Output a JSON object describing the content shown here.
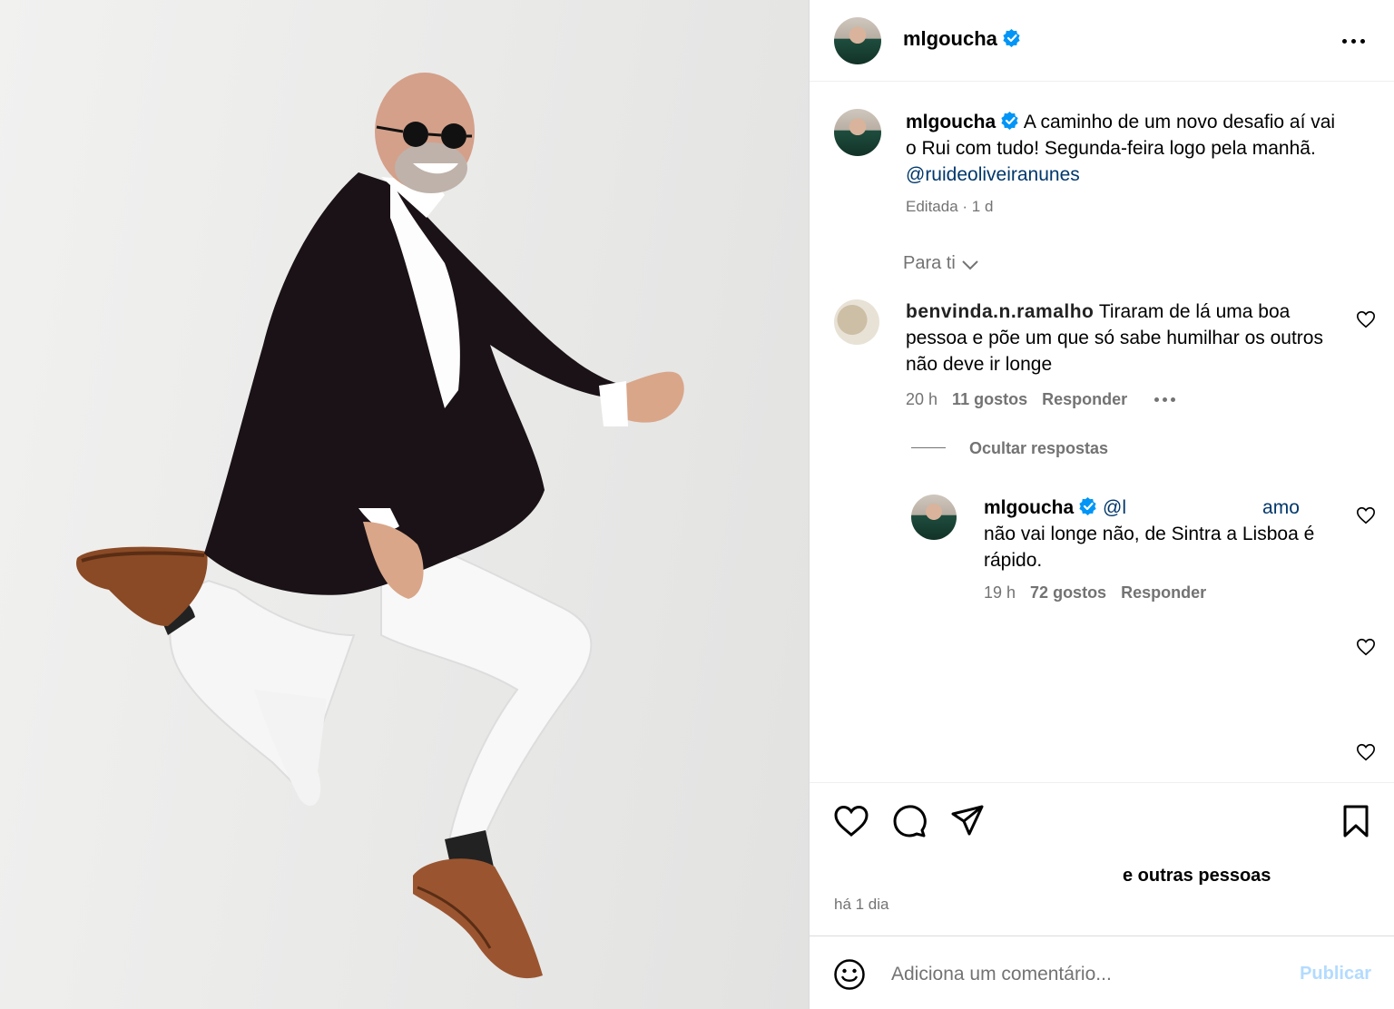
{
  "post": {
    "author": "mlgoucha",
    "caption_prefix": "A caminho de um novo desafio aí vai o Rui com tudo! Segunda-feira logo pela manhã. ",
    "caption_mention": "@ruideoliveiranunes",
    "caption_meta": "Editada · 1 d"
  },
  "comments": {
    "sort_label": "Para ti",
    "first": {
      "username": "benvinda.n.ramalho",
      "text": " Tiraram de lá uma boa pessoa e põe um que só sabe humilhar os outros não deve ir longe",
      "time": "20 h",
      "likes": "11 gostos",
      "reply": "Responder"
    },
    "hide_replies": "Ocultar respostas",
    "reply": {
      "username": "mlgoucha",
      "mention": "@l",
      "mention_tail": "amo",
      "text": "não vai longe não, de Sintra a Lisboa é rápido.",
      "time": "19 h",
      "likes": "72 gostos",
      "reply": "Responder"
    }
  },
  "actions": {
    "likes_text": "e outras pessoas",
    "date": "há 1 dia"
  },
  "add_comment": {
    "placeholder": "Adiciona um comentário...",
    "publish": "Publicar"
  },
  "colors": {
    "verified": "#0095f6",
    "mention": "#00376b",
    "muted": "#737373",
    "publish_disabled": "#b3dbff"
  },
  "icons": [
    "verified-icon",
    "more-icon",
    "chevron-down-icon",
    "heart-icon",
    "comment-icon",
    "share-icon",
    "bookmark-icon",
    "emoji-icon"
  ]
}
